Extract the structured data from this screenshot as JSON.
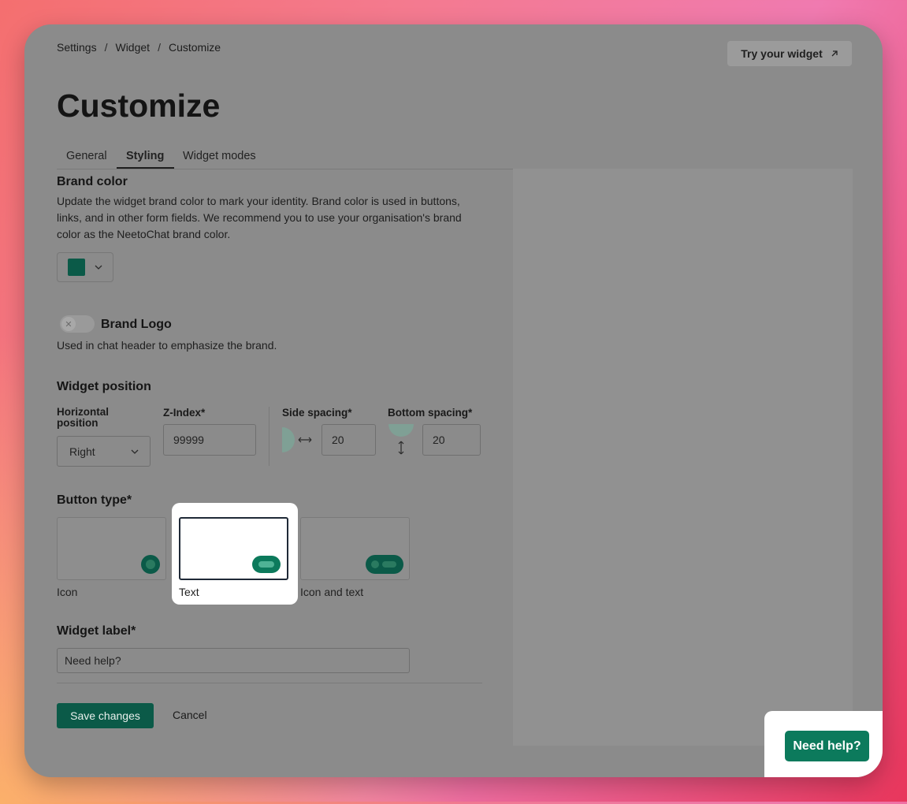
{
  "breadcrumb": [
    "Settings",
    "Widget",
    "Customize"
  ],
  "breadcrumb_sep": "/",
  "header": {
    "try_button": "Try your widget",
    "try_icon": "arrow-up-right-icon",
    "title": "Customize"
  },
  "tabs": [
    {
      "label": "General"
    },
    {
      "label": "Styling",
      "active": true
    },
    {
      "label": "Widget modes"
    }
  ],
  "brand_color": {
    "heading": "Brand color",
    "description": "Update the widget brand color to mark your identity. Brand color is used in buttons, links, and in other form fields. We recommend you to use your organisation's brand color as the NeetoChat brand color.",
    "value": "#0b5a48"
  },
  "brand_logo": {
    "label": "Brand Logo",
    "description": "Used in chat header to emphasize the brand.",
    "enabled": false
  },
  "widget_position": {
    "heading": "Widget position",
    "horizontal_label": "Horizontal position",
    "horizontal_value": "Right",
    "zindex_label": "Z-Index*",
    "zindex_value": "99999",
    "side_label": "Side spacing*",
    "side_value": "20",
    "bottom_label": "Bottom spacing*",
    "bottom_value": "20"
  },
  "button_type": {
    "heading": "Button type*",
    "options": [
      {
        "label": "Icon"
      },
      {
        "label": "Text",
        "selected": true
      },
      {
        "label": "Icon and text"
      }
    ]
  },
  "widget_label": {
    "heading": "Widget label*",
    "value": "Need help?"
  },
  "actions": {
    "save": "Save changes",
    "cancel": "Cancel"
  },
  "launcher": {
    "label": "Need help?"
  },
  "colors": {
    "accent": "#0b7a5c",
    "brand": "#0b5a48"
  }
}
